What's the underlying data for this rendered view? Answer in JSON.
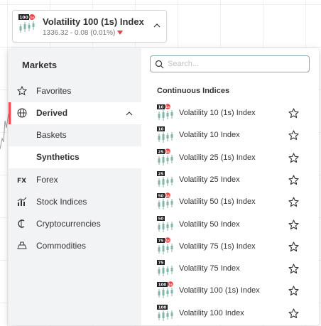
{
  "selector": {
    "symbol_badge": "100",
    "symbol_badge_sub": "1s",
    "name": "Volatility 100 (1s) Index",
    "quote": "1336.32 - 0.08 (0.01%)",
    "change_direction": "down",
    "down_color": "#ec3f3f"
  },
  "sidebar": {
    "title": "Markets",
    "items": [
      {
        "label": "Favorites",
        "icon": "star-icon"
      },
      {
        "label": "Derived",
        "icon": "globe-icon",
        "expanded": true
      },
      {
        "label": "Forex",
        "icon": "forex-icon"
      },
      {
        "label": "Stock Indices",
        "icon": "stock-indices-icon"
      },
      {
        "label": "Cryptocurrencies",
        "icon": "crypto-icon"
      },
      {
        "label": "Commodities",
        "icon": "commodities-icon"
      }
    ],
    "sub_items": [
      {
        "label": "Baskets"
      },
      {
        "label": "Synthetics",
        "selected": true
      }
    ],
    "accent_color": "#ff444f"
  },
  "content": {
    "search_placeholder": "Search...",
    "section_title": "Continuous Indices",
    "markets": [
      {
        "badge": "10",
        "one_second": true,
        "name": "Volatility 10 (1s) Index"
      },
      {
        "badge": "10",
        "one_second": false,
        "name": "Volatility 10 Index"
      },
      {
        "badge": "25",
        "one_second": true,
        "name": "Volatility 25 (1s) Index"
      },
      {
        "badge": "25",
        "one_second": false,
        "name": "Volatility 25 Index"
      },
      {
        "badge": "50",
        "one_second": true,
        "name": "Volatility 50 (1s) Index"
      },
      {
        "badge": "50",
        "one_second": false,
        "name": "Volatility 50 Index"
      },
      {
        "badge": "75",
        "one_second": true,
        "name": "Volatility 75 (1s) Index"
      },
      {
        "badge": "75",
        "one_second": false,
        "name": "Volatility 75 Index"
      },
      {
        "badge": "100",
        "one_second": true,
        "name": "Volatility 100 (1s) Index"
      },
      {
        "badge": "100",
        "one_second": false,
        "name": "Volatility 100 Index"
      }
    ],
    "one_second_label": "1s"
  }
}
